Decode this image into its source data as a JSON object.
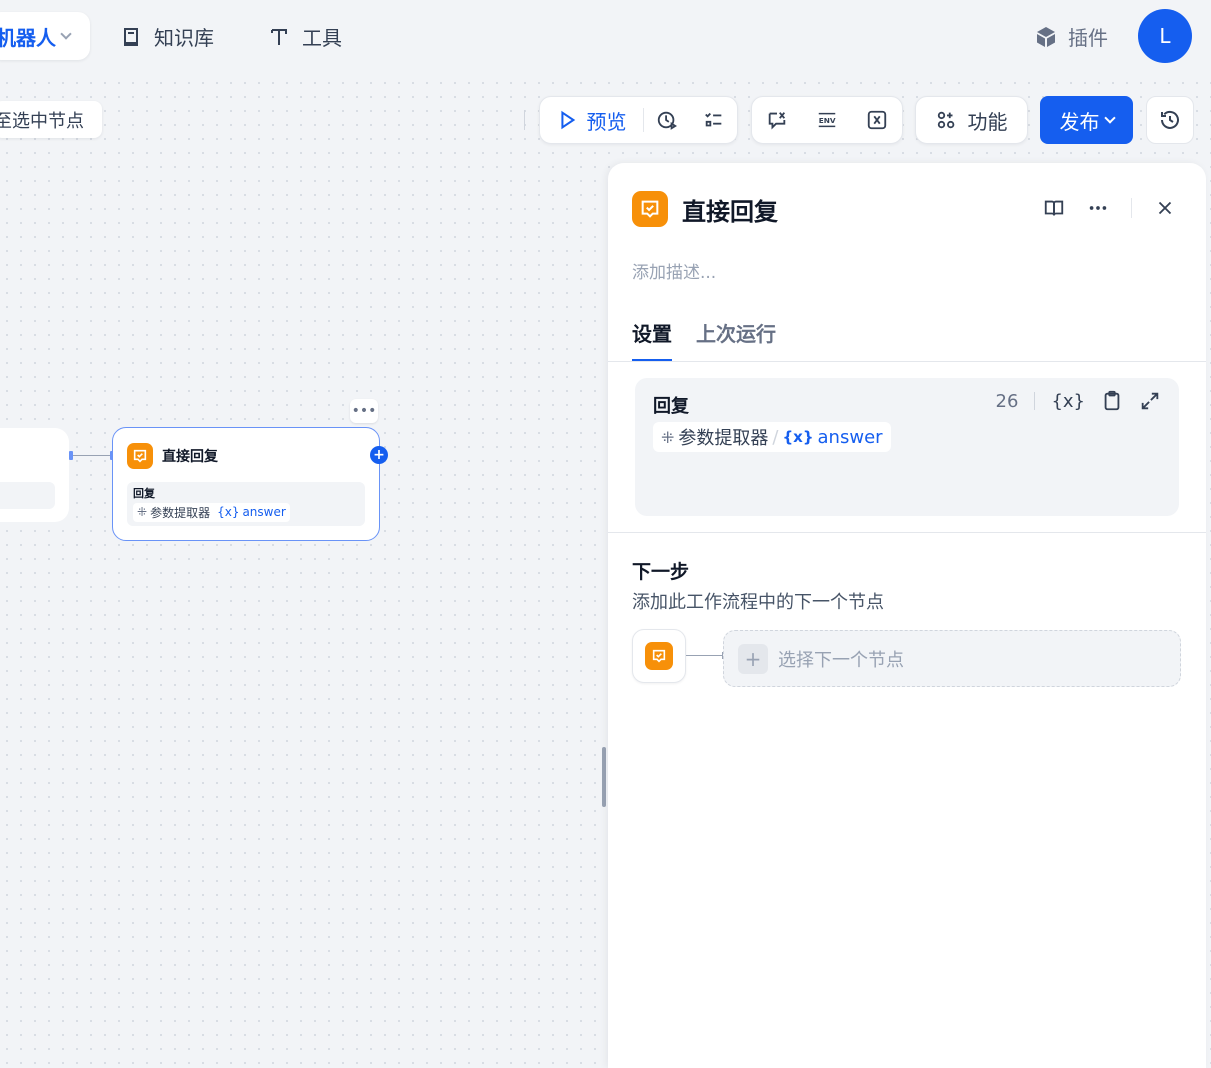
{
  "topbar": {
    "app_label": "机器人",
    "nav": [
      {
        "label": "知识库",
        "icon": "book-icon"
      },
      {
        "label": "工具",
        "icon": "tool-icon"
      }
    ],
    "plugin_label": "插件",
    "avatar_initial": "L"
  },
  "canvas_toolbar": {
    "hint": "至选中节点",
    "preview_label": "预览",
    "feature_label": "功能",
    "publish_label": "发布"
  },
  "canvas_node": {
    "title": "直接回复",
    "field_label": "回复",
    "source": "参数提取器",
    "variable_prefix": "{x}",
    "variable": "answer"
  },
  "panel": {
    "title": "直接回复",
    "description_placeholder": "添加描述...",
    "tabs": [
      {
        "label": "设置",
        "active": true
      },
      {
        "label": "上次运行",
        "active": false
      }
    ],
    "reply": {
      "label": "回复",
      "count": "26",
      "var_button": "{x}",
      "source": "参数提取器",
      "separator": "/",
      "variable_prefix": "{x}",
      "variable": "answer"
    },
    "next_step": {
      "title": "下一步",
      "description": "添加此工作流程中的下一个节点",
      "select_label": "选择下一个节点"
    }
  },
  "colors": {
    "accent": "#155eef",
    "node_icon": "#f79009"
  }
}
